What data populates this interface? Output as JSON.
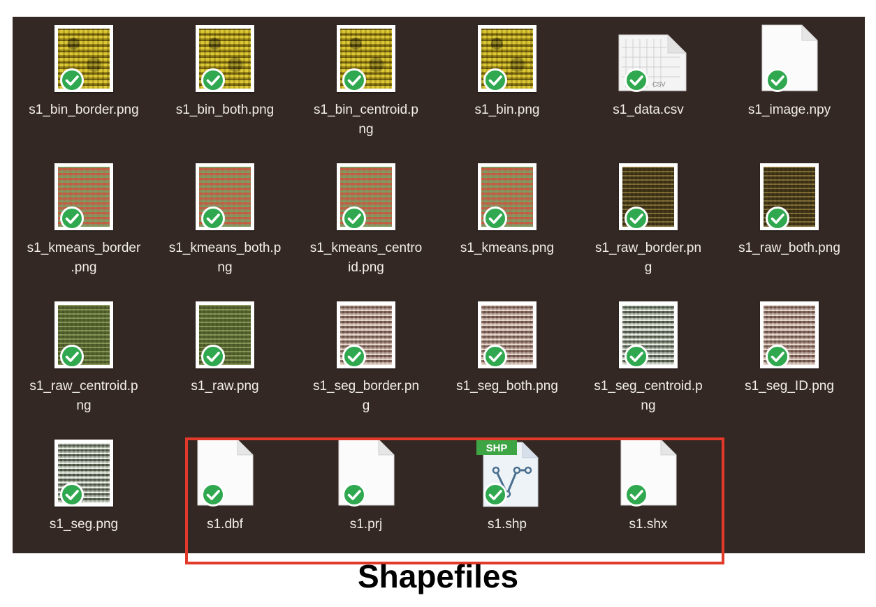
{
  "colors": {
    "window_background": "#342824",
    "highlight_border": "#e2392a",
    "check_badge": "#2fa84f",
    "label_text": "#f2eeea"
  },
  "files": [
    {
      "name": "s1_bin_border.png",
      "label": "s1_bin_border.png",
      "icon": "image-thumbnail-icon",
      "thumb": "yellow",
      "synced": true
    },
    {
      "name": "s1_bin_both.png",
      "label": "s1_bin_both.png",
      "icon": "image-thumbnail-icon",
      "thumb": "yellow",
      "synced": true
    },
    {
      "name": "s1_bin_centroid.png",
      "label": "s1_bin_centroid.p\nng",
      "icon": "image-thumbnail-icon",
      "thumb": "yellow",
      "synced": true
    },
    {
      "name": "s1_bin.png",
      "label": "s1_bin.png",
      "icon": "image-thumbnail-icon",
      "thumb": "yellow",
      "synced": true
    },
    {
      "name": "s1_data.csv",
      "label": "s1_data.csv",
      "icon": "csv-document-icon",
      "thumb": "csv",
      "badge_text": "CSV",
      "synced": true
    },
    {
      "name": "s1_image.npy",
      "label": "s1_image.npy",
      "icon": "blank-document-icon",
      "thumb": "blank",
      "synced": true
    },
    {
      "name": "s1_kmeans_border.png",
      "label": "s1_kmeans_border\n.png",
      "icon": "image-thumbnail-icon",
      "thumb": "red",
      "synced": true
    },
    {
      "name": "s1_kmeans_both.png",
      "label": "s1_kmeans_both.p\nng",
      "icon": "image-thumbnail-icon",
      "thumb": "red",
      "synced": true
    },
    {
      "name": "s1_kmeans_centroid.png",
      "label": "s1_kmeans_centro\nid.png",
      "icon": "image-thumbnail-icon",
      "thumb": "red",
      "synced": true
    },
    {
      "name": "s1_kmeans.png",
      "label": "s1_kmeans.png",
      "icon": "image-thumbnail-icon",
      "thumb": "red",
      "synced": true
    },
    {
      "name": "s1_raw_border.png",
      "label": "s1_raw_border.pn\ng",
      "icon": "image-thumbnail-icon",
      "thumb": "brown",
      "synced": true
    },
    {
      "name": "s1_raw_both.png",
      "label": "s1_raw_both.png",
      "icon": "image-thumbnail-icon",
      "thumb": "brown",
      "synced": true
    },
    {
      "name": "s1_raw_centroid.png",
      "label": "s1_raw_centroid.p\nng",
      "icon": "image-thumbnail-icon",
      "thumb": "green",
      "synced": true
    },
    {
      "name": "s1_raw.png",
      "label": "s1_raw.png",
      "icon": "image-thumbnail-icon",
      "thumb": "green",
      "synced": true
    },
    {
      "name": "s1_seg_border.png",
      "label": "s1_seg_border.pn\ng",
      "icon": "image-thumbnail-icon",
      "thumb": "pink",
      "synced": true
    },
    {
      "name": "s1_seg_both.png",
      "label": "s1_seg_both.png",
      "icon": "image-thumbnail-icon",
      "thumb": "pink",
      "synced": true
    },
    {
      "name": "s1_seg_centroid.png",
      "label": "s1_seg_centroid.p\nng",
      "icon": "image-thumbnail-icon",
      "thumb": "grey",
      "synced": true
    },
    {
      "name": "s1_seg_ID.png",
      "label": "s1_seg_ID.png",
      "icon": "image-thumbnail-icon",
      "thumb": "pink",
      "synced": true
    },
    {
      "name": "s1_seg.png",
      "label": "s1_seg.png",
      "icon": "image-thumbnail-icon",
      "thumb": "grey",
      "synced": true
    },
    {
      "name": "s1.dbf",
      "label": "s1.dbf",
      "icon": "blank-document-icon",
      "thumb": "blank",
      "synced": true
    },
    {
      "name": "s1.prj",
      "label": "s1.prj",
      "icon": "blank-document-icon",
      "thumb": "blank",
      "synced": true
    },
    {
      "name": "s1.shp",
      "label": "s1.shp",
      "icon": "shapefile-document-icon",
      "thumb": "shp",
      "badge_text": "SHP",
      "synced": true
    },
    {
      "name": "s1.shx",
      "label": "s1.shx",
      "icon": "blank-document-icon",
      "thumb": "blank",
      "synced": true
    }
  ],
  "highlight": {
    "caption": "Shapefiles",
    "files": [
      "s1.dbf",
      "s1.prj",
      "s1.shp",
      "s1.shx"
    ]
  }
}
